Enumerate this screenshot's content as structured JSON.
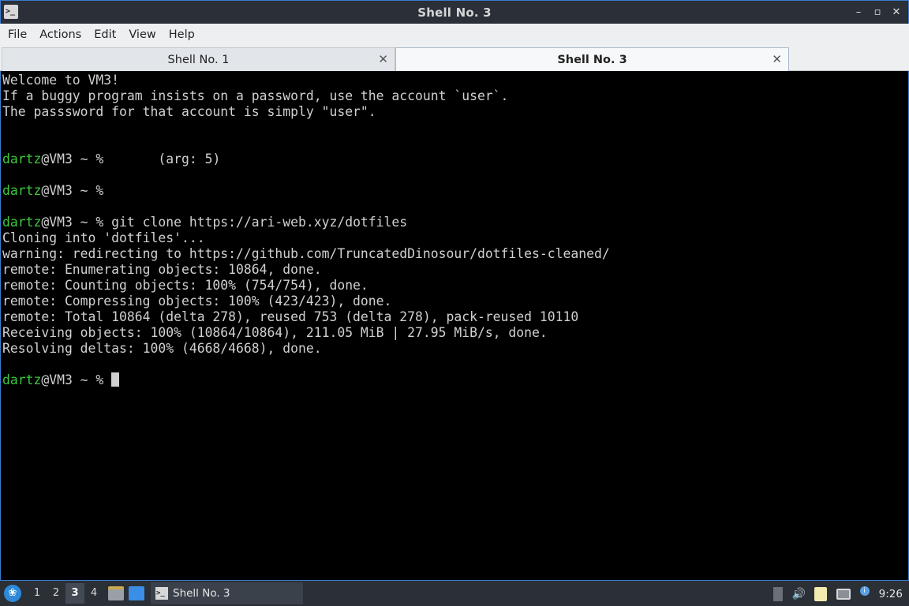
{
  "window": {
    "title": "Shell No. 3",
    "app_icon": "terminal-icon"
  },
  "menu": [
    "File",
    "Actions",
    "Edit",
    "View",
    "Help"
  ],
  "tabs": [
    {
      "label": "Shell No. 1",
      "active": false
    },
    {
      "label": "Shell No. 3",
      "active": true
    }
  ],
  "terminal": {
    "lines": [
      {
        "text": "Welcome to VM3!"
      },
      {
        "text": "If a buggy program insists on a password, use the account `user`."
      },
      {
        "text": "The passsword for that account is simply \"user\"."
      },
      {
        "text": ""
      },
      {
        "text": ""
      },
      {
        "prompt": "dartz",
        "text": "@VM3 ~ %       (arg: 5)"
      },
      {
        "text": ""
      },
      {
        "prompt": "dartz",
        "text": "@VM3 ~ %"
      },
      {
        "text": ""
      },
      {
        "prompt": "dartz",
        "text": "@VM3 ~ % git clone https://ari-web.xyz/dotfiles"
      },
      {
        "text": "Cloning into 'dotfiles'..."
      },
      {
        "text": "warning: redirecting to https://github.com/TruncatedDinosour/dotfiles-cleaned/"
      },
      {
        "text": "remote: Enumerating objects: 10864, done."
      },
      {
        "text": "remote: Counting objects: 100% (754/754), done."
      },
      {
        "text": "remote: Compressing objects: 100% (423/423), done."
      },
      {
        "text": "remote: Total 10864 (delta 278), reused 753 (delta 278), pack-reused 10110"
      },
      {
        "text": "Receiving objects: 100% (10864/10864), 211.05 MiB | 27.95 MiB/s, done."
      },
      {
        "text": "Resolving deltas: 100% (4668/4668), done."
      },
      {
        "text": ""
      },
      {
        "prompt": "dartz",
        "text": "@VM3 ~ % ",
        "cursor": true
      }
    ]
  },
  "taskbar": {
    "desktops": [
      {
        "label": "1",
        "active": false
      },
      {
        "label": "2",
        "active": false
      },
      {
        "label": "3",
        "active": true
      },
      {
        "label": "4",
        "active": false
      }
    ],
    "task": {
      "label": "Shell No. 3"
    },
    "clock": "9:26"
  }
}
